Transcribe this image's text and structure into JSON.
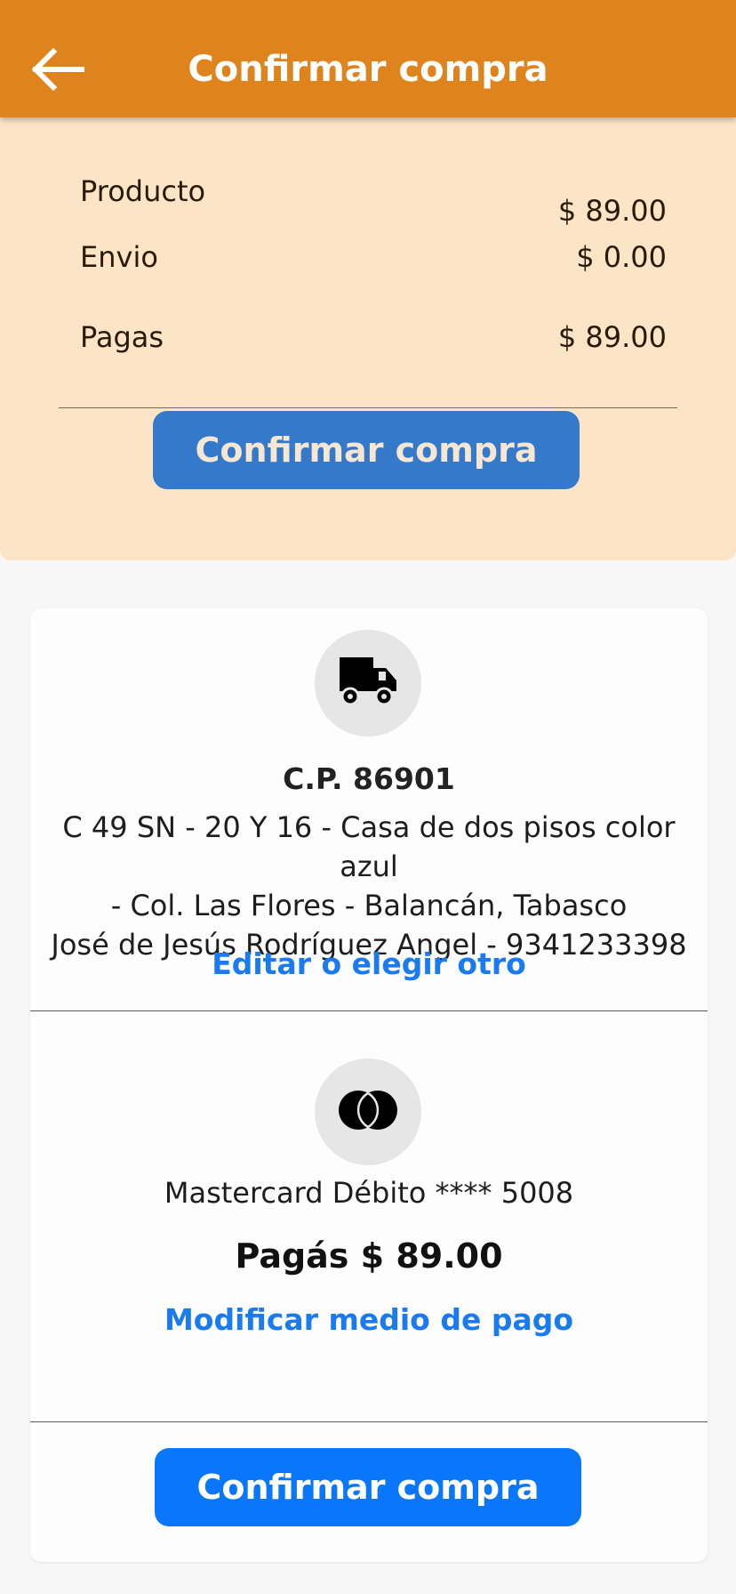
{
  "appbar": {
    "title": "Confirmar compra",
    "back_icon": "arrow-left-icon"
  },
  "summary": {
    "product_label": "Producto",
    "product_value": "$ 89.00",
    "shipping_label": "Envio",
    "shipping_value": "$ 0.00",
    "total_label": "Pagas",
    "total_value": "$ 89.00",
    "confirm_label": "Confirmar compra"
  },
  "shipping": {
    "icon": "truck-icon",
    "postal_code": "C.P. 86901",
    "address_line1": "C 49 SN - 20 Y 16 - Casa de dos pisos color azul",
    "address_line2": "- Col. Las Flores - Balancán, Tabasco",
    "recipient": "José de Jesús Rodríguez Angel - 9341233398",
    "edit_link": "Editar o elegir otro"
  },
  "payment": {
    "icon": "mastercard-icon",
    "method": "Mastercard Débito **** 5008",
    "amount": "Pagás $ 89.00",
    "modify_link": "Modificar medio de pago"
  },
  "footer": {
    "confirm_label": "Confirmar compra"
  },
  "colors": {
    "appbar": "#df841d",
    "summary_bg": "#fce4c7",
    "top_button": "#3579ca",
    "bottom_button": "#0a77fb",
    "link": "#1a7af0"
  }
}
